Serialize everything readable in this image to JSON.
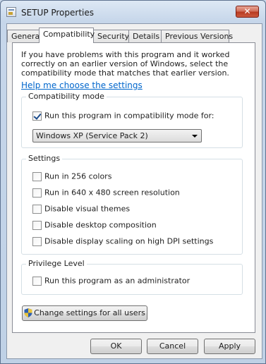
{
  "window": {
    "title": "SETUP Properties",
    "close_glyph": "✕"
  },
  "tabs": [
    {
      "label": "General",
      "active": false
    },
    {
      "label": "Compatibility",
      "active": true
    },
    {
      "label": "Security",
      "active": false
    },
    {
      "label": "Details",
      "active": false
    },
    {
      "label": "Previous Versions",
      "active": false
    }
  ],
  "compat": {
    "intro": "If you have problems with this program and it worked correctly on an earlier version of Windows, select the compatibility mode that matches that earlier version.",
    "help_link": "Help me choose the settings",
    "mode_group": {
      "title": "Compatibility mode",
      "checkbox_label": "Run this program in compatibility mode for:",
      "checked": true,
      "selected_os": "Windows XP (Service Pack 2)"
    },
    "settings_group": {
      "title": "Settings",
      "items": [
        {
          "label": "Run in 256 colors",
          "checked": false
        },
        {
          "label": "Run in 640 x 480 screen resolution",
          "checked": false
        },
        {
          "label": "Disable visual themes",
          "checked": false
        },
        {
          "label": "Disable desktop composition",
          "checked": false
        },
        {
          "label": "Disable display scaling on high DPI settings",
          "checked": false
        }
      ]
    },
    "privilege_group": {
      "title": "Privilege Level",
      "checkbox_label": "Run this program as an administrator",
      "checked": false
    },
    "change_all_users_button": "Change settings for all users"
  },
  "footer": {
    "ok": "OK",
    "cancel": "Cancel",
    "apply": "Apply"
  },
  "icons": {
    "app": "setup-app-icon",
    "close": "close-icon",
    "shield": "uac-shield-icon",
    "dropdown": "chevron-down-icon"
  },
  "colors": {
    "link": "#0066cc",
    "close_button": "#c44a30",
    "window_frame": "#c6d6ea"
  }
}
